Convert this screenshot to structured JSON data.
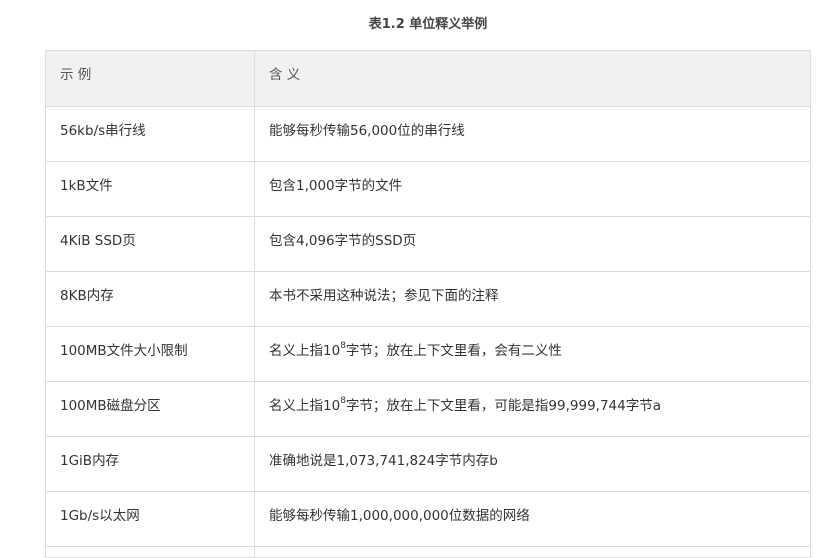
{
  "caption": "表1.2 单位释义举例",
  "table": {
    "headers": [
      "示 例",
      "含 义"
    ],
    "rows": [
      {
        "example": "56kb/s串行线",
        "meaning": "能够每秒传输56,000位的串行线"
      },
      {
        "example": "1kB文件",
        "meaning": "包含1,000字节的文件"
      },
      {
        "example": "4KiB SSD页",
        "meaning": "包含4,096字节的SSD页"
      },
      {
        "example": "8KB内存",
        "meaning": "本书不采用这种说法；参见下面的注释"
      },
      {
        "example": "100MB文件大小限制",
        "meaning_pre": "名义上指10",
        "meaning_sup": "8",
        "meaning_post": "字节；放在上下文里看，会有二义性"
      },
      {
        "example": "100MB磁盘分区",
        "meaning_pre": "名义上指10",
        "meaning_sup": "8",
        "meaning_post": "字节；放在上下文里看，可能是指99,999,744字节a"
      },
      {
        "example": "1GiB内存",
        "meaning": "准确地说是1,073,741,824字节内存b"
      },
      {
        "example": "1Gb/s以太网",
        "meaning": "能够每秒传输1,000,000,000位数据的网络"
      }
    ]
  }
}
